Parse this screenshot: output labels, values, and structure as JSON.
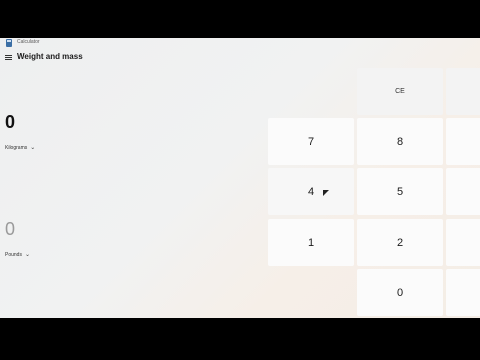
{
  "app": {
    "title": "Calculator"
  },
  "header": {
    "mode": "Weight and mass"
  },
  "converter": {
    "from_value": "0",
    "from_unit": "Kilograms",
    "to_value": "0",
    "to_unit": "Pounds"
  },
  "keypad": {
    "ce": "CE",
    "k7": "7",
    "k8": "8",
    "k4": "4",
    "k5": "5",
    "k1": "1",
    "k2": "2",
    "k0": "0"
  }
}
